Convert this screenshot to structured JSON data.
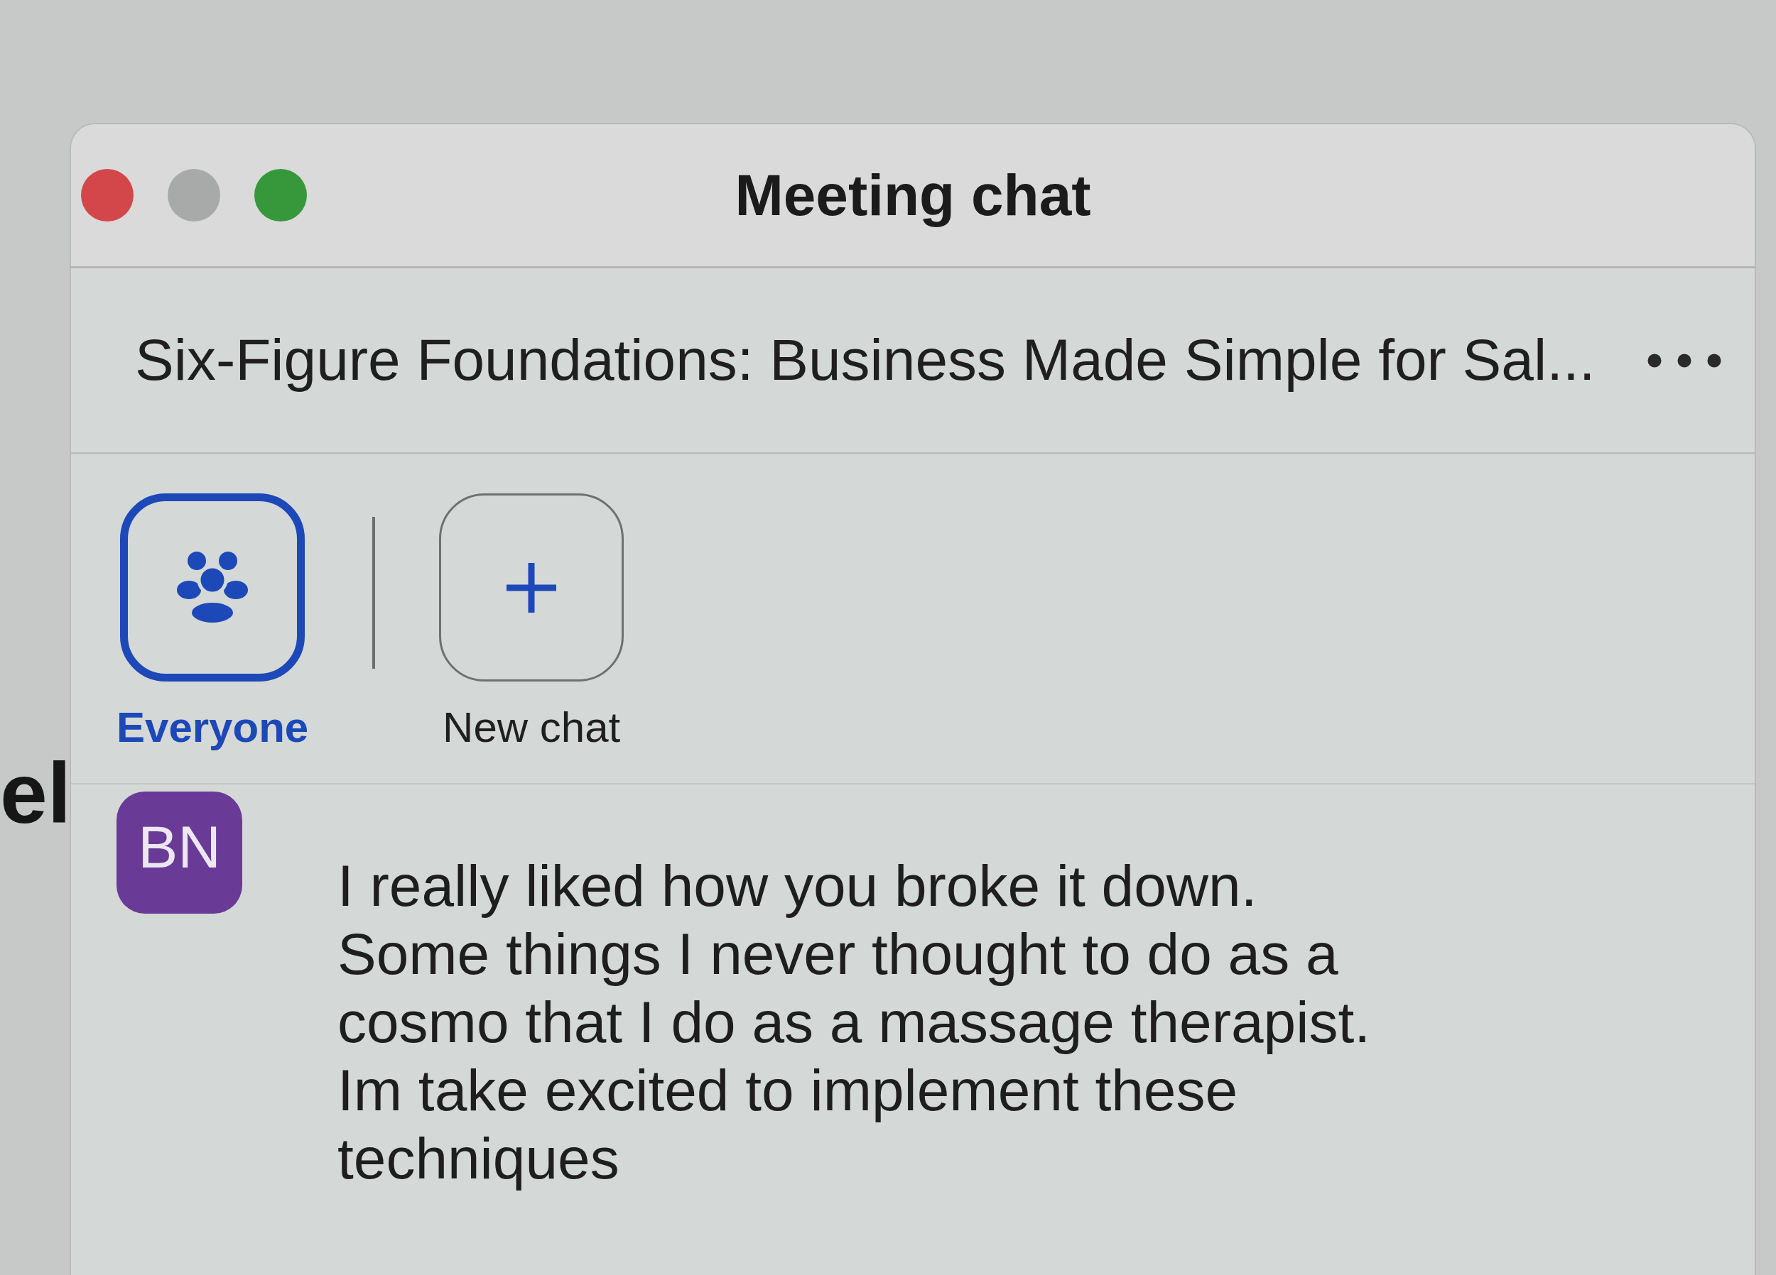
{
  "window": {
    "title": "Meeting chat",
    "controls": [
      {
        "kind": "close",
        "disabled": false
      },
      {
        "kind": "minimize",
        "disabled": true
      },
      {
        "kind": "maximize",
        "disabled": false
      }
    ]
  },
  "meeting": {
    "title": "Six-Figure Foundations: Business Made Simple for Sal..."
  },
  "chats": [
    {
      "kind": "group",
      "label": "Everyone",
      "selected": true
    },
    {
      "kind": "new",
      "label": "New chat",
      "selected": false
    }
  ],
  "messages": [
    {
      "initials": "BN",
      "text": "I really liked how you broke it down. Some things I never thought to do as a cosmo that I do as a massage therapist. Im take excited to implement these techniques"
    }
  ],
  "background_window": {
    "text_fragment": "el"
  }
}
